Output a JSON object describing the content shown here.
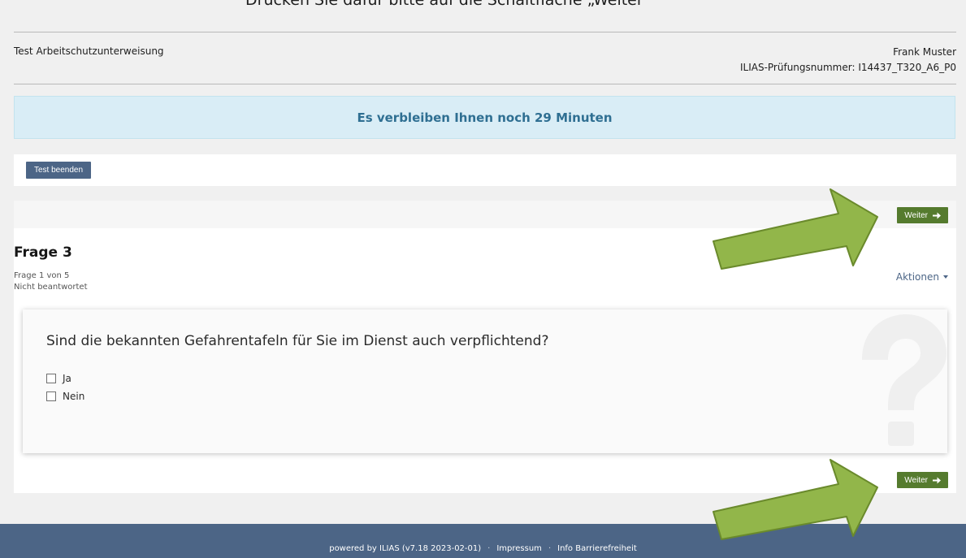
{
  "clipped_top_text": "Drücken Sie dafür bitte auf die Schaltfläche „Weiter\"",
  "header": {
    "test_title": "Test Arbeitschutzunterweisung",
    "user_name": "Frank Muster",
    "exam_number": "ILIAS-Prüfungsnummer: I14437_T320_A6_P0"
  },
  "timer": {
    "text": "Es verbleiben Ihnen noch 29 Minuten"
  },
  "toolbar": {
    "end_test_label": "Test beenden"
  },
  "nav": {
    "next_label": "Weiter",
    "next_icon": "arrow-right-icon"
  },
  "question": {
    "title": "Frage 3",
    "position": "Frage 1 von 5",
    "status": "Nicht beantwortet",
    "actions_label": "Aktionen",
    "text": "Sind die bekannten Gefahrentafeln für Sie im Dienst auch verpflichtend?",
    "answers": [
      {
        "label": "Ja",
        "checked": false
      },
      {
        "label": "Nein",
        "checked": false
      }
    ]
  },
  "footer": {
    "powered_by": "powered by ILIAS (v7.18 2023-02-01)",
    "separator": "·",
    "links": [
      "Impressum",
      "Info Barrierefreiheit"
    ]
  },
  "colors": {
    "primary": "#4c6586",
    "next_button": "#557b2e",
    "timer_bg": "#d9edf6",
    "timer_text": "#2f6f92",
    "annotation_arrow": "#92b64a"
  }
}
